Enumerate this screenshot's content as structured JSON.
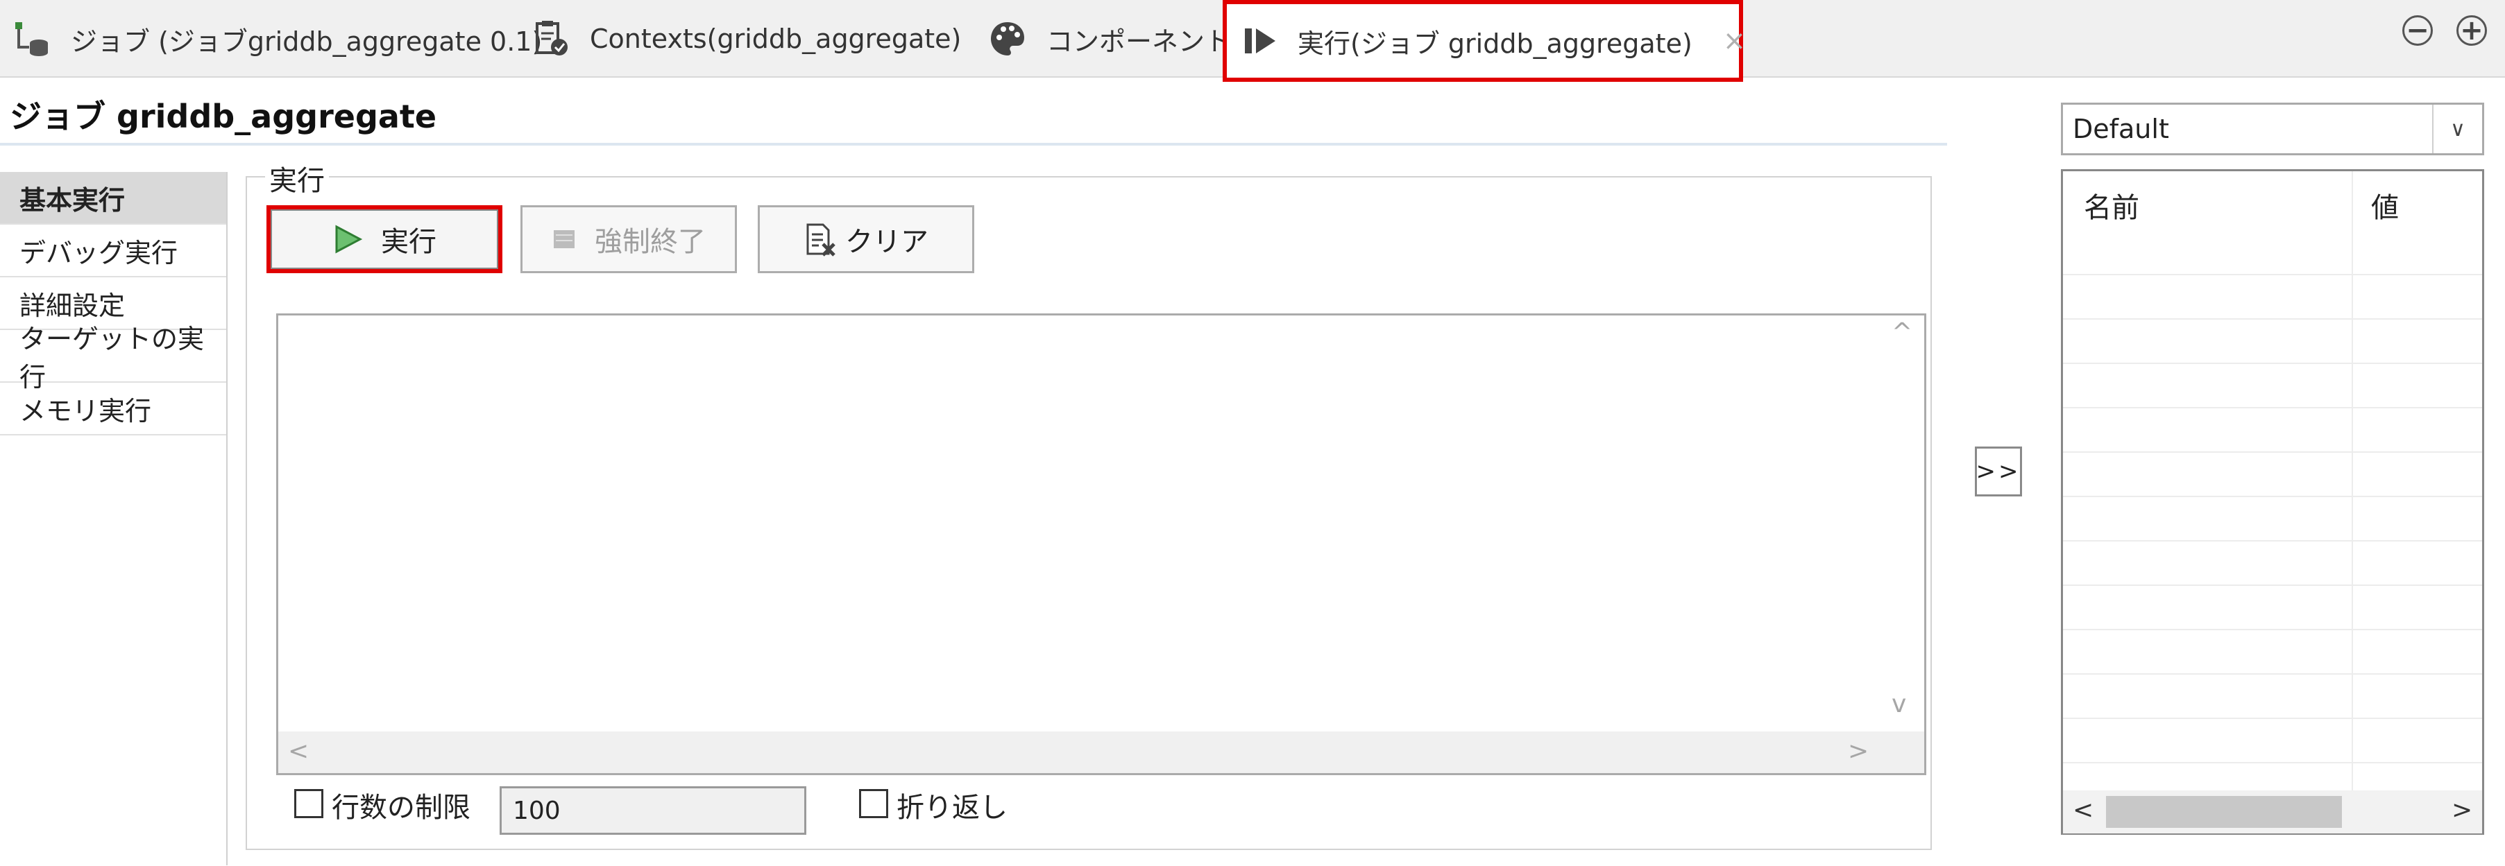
{
  "tabs": [
    {
      "label": "ジョブ (ジョブgriddb_aggregate 0.1)",
      "icon": "job-icon"
    },
    {
      "label": "Contexts(griddb_aggregate)",
      "icon": "contexts-icon"
    },
    {
      "label": "コンポーネント",
      "icon": "palette-icon"
    },
    {
      "label": "実行(ジョブ  griddb_aggregate)",
      "icon": "run-icon",
      "active": true,
      "close": "×"
    }
  ],
  "window": {
    "minimize": "−",
    "maximize": "+"
  },
  "job_title": "ジョブ  griddb_aggregate",
  "nav": [
    "基本実行",
    "デバッグ実行",
    "詳細設定",
    "ターゲットの実行",
    "メモリ実行"
  ],
  "group_label": "実行",
  "buttons": {
    "run": "実行",
    "kill": "強制終了",
    "clear": "クリア"
  },
  "options": {
    "limit_label": "行数の制限",
    "limit_value": "100",
    "wrap_label": "折り返し"
  },
  "move_button": ">>",
  "context": {
    "selected": "Default",
    "columns": [
      "名前",
      "値"
    ]
  },
  "colors": {
    "highlight": "#e00000",
    "play": "#2e9e3e"
  }
}
